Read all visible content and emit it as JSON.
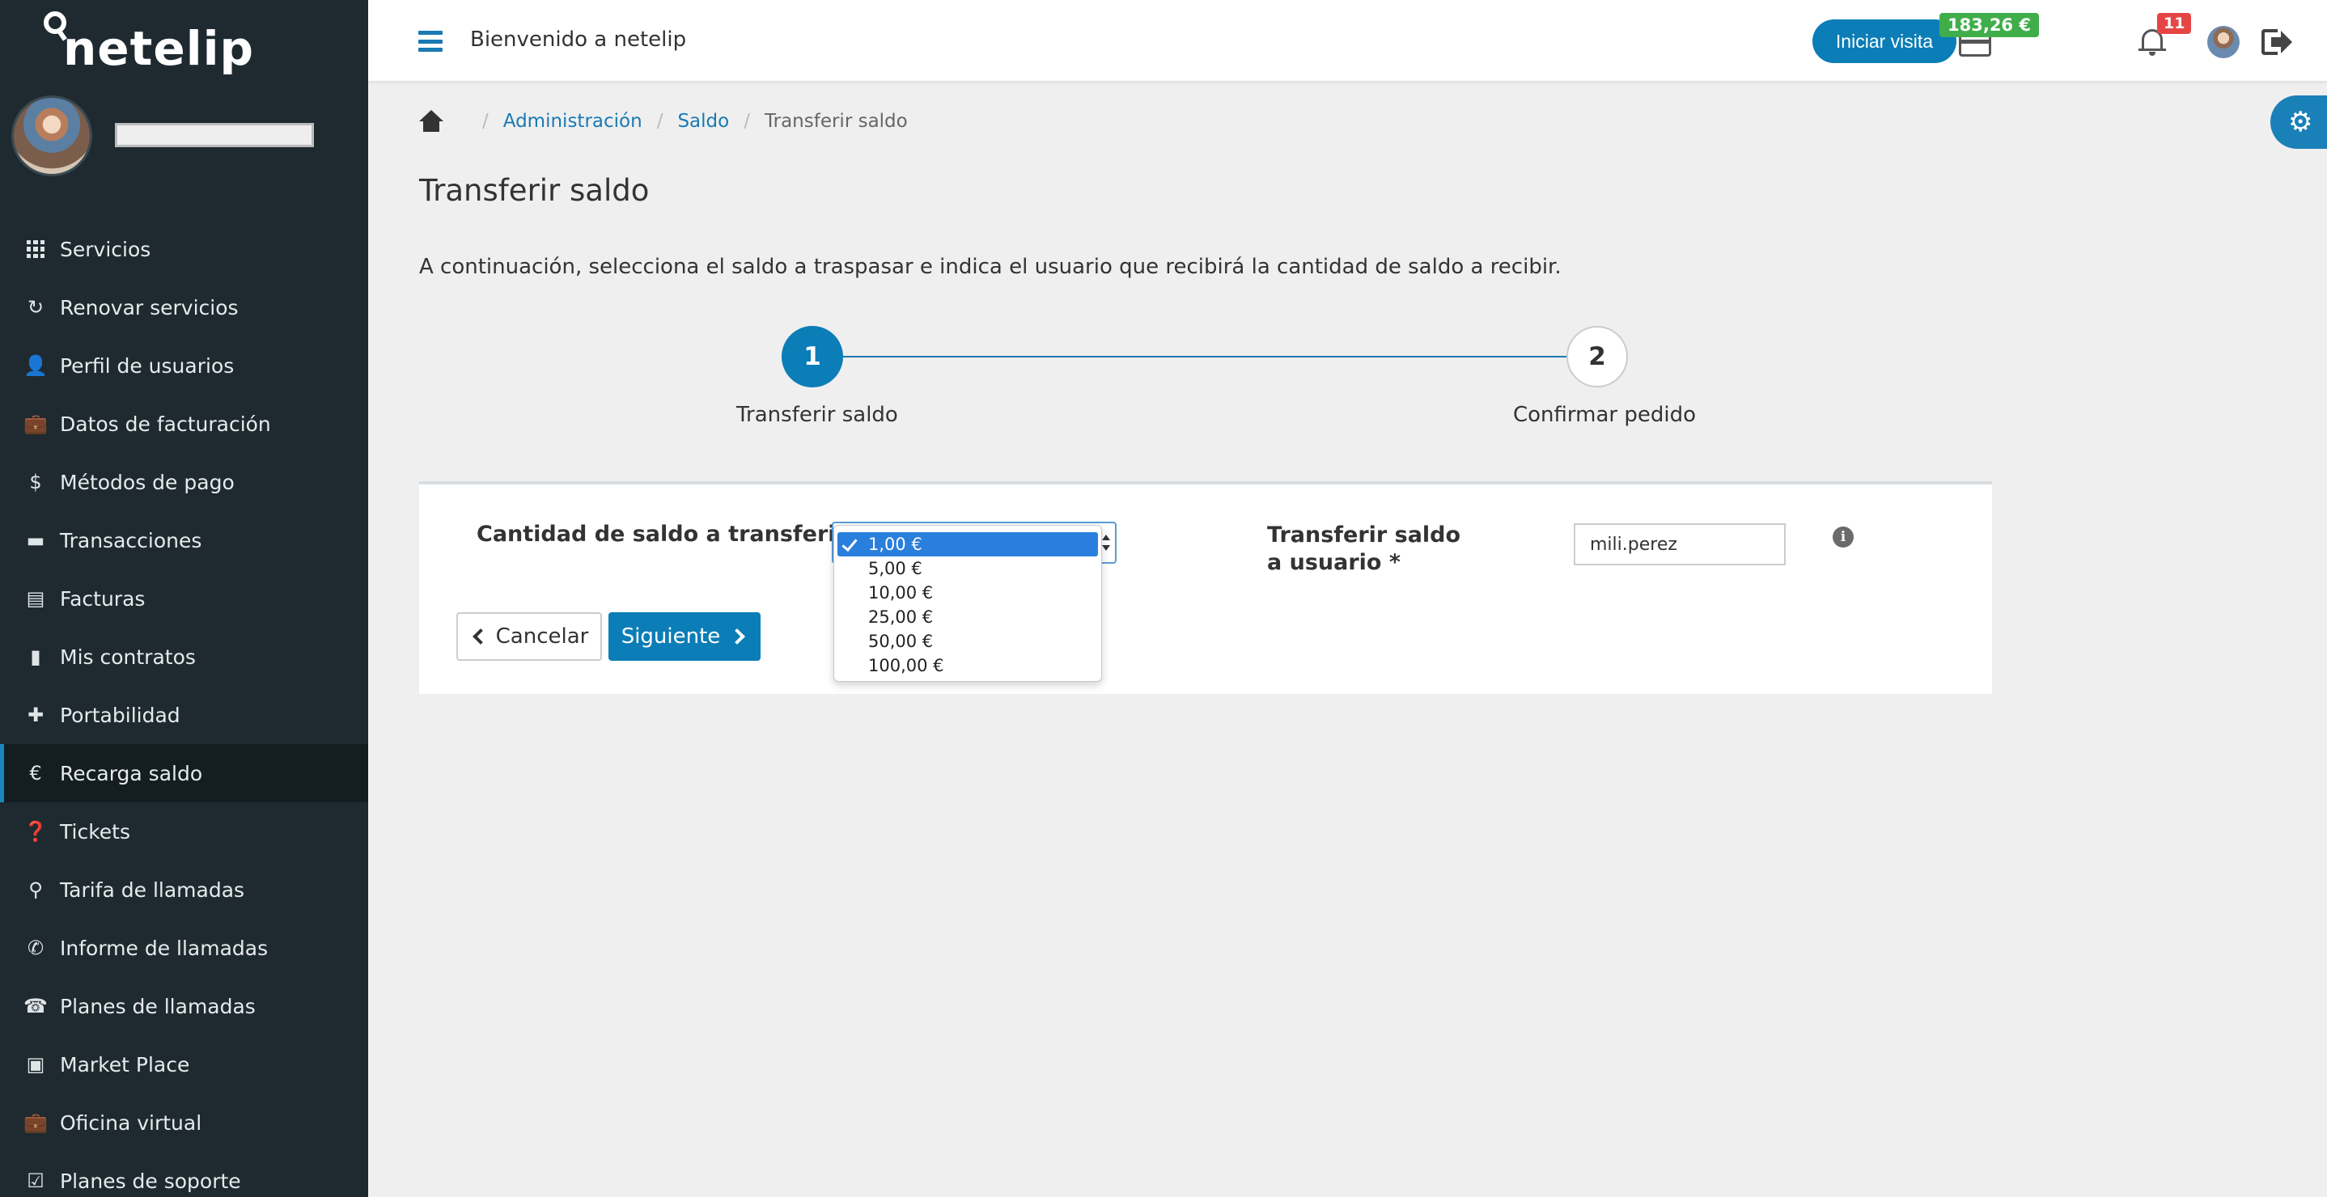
{
  "brand": {
    "logo_text": "netelip",
    "accent": "#0b7db7",
    "sidebar_bg": "#1e2a30"
  },
  "sidebar": {
    "items": [
      {
        "label": "Servicios",
        "icon": "grid-icon"
      },
      {
        "label": "Renovar servicios",
        "icon": "refresh-icon"
      },
      {
        "label": "Perfil de usuarios",
        "icon": "user-icon"
      },
      {
        "label": "Datos de facturación",
        "icon": "briefcase-icon"
      },
      {
        "label": "Métodos de pago",
        "icon": "dollar-icon"
      },
      {
        "label": "Transacciones",
        "icon": "credit-card-icon"
      },
      {
        "label": "Facturas",
        "icon": "invoice-icon"
      },
      {
        "label": "Mis contratos",
        "icon": "file-icon"
      },
      {
        "label": "Portabilidad",
        "icon": "plus-icon"
      },
      {
        "label": "Recarga saldo",
        "icon": "euro-icon",
        "active": true
      },
      {
        "label": "Tickets",
        "icon": "question-icon"
      },
      {
        "label": "Tarifa de llamadas",
        "icon": "search-icon"
      },
      {
        "label": "Informe de llamadas",
        "icon": "phone-icon"
      },
      {
        "label": "Planes de llamadas",
        "icon": "desk-phone-icon"
      },
      {
        "label": "Market Place",
        "icon": "market-icon"
      },
      {
        "label": "Oficina virtual",
        "icon": "briefcase-icon"
      },
      {
        "label": "Planes de soporte",
        "icon": "checkbox-icon"
      }
    ]
  },
  "header": {
    "welcome": "Bienvenido a netelip",
    "visit_button": "Iniciar visita",
    "balance": "183,26 €",
    "notifications_count": "11"
  },
  "breadcrumb": {
    "items": [
      "Administración",
      "Saldo"
    ],
    "current": "Transferir saldo"
  },
  "page": {
    "title": "Transferir saldo",
    "intro": "A continuación, selecciona el saldo a traspasar e indica el usuario que recibirá la cantidad de saldo a recibir."
  },
  "stepper": {
    "steps": [
      {
        "number": "1",
        "label": "Transferir saldo",
        "active": true
      },
      {
        "number": "2",
        "label": "Confirmar pedido",
        "active": false
      }
    ]
  },
  "form": {
    "amount_label": "Cantidad de saldo a transferir",
    "amount_options": [
      "1,00 €",
      "5,00 €",
      "10,00 €",
      "25,00 €",
      "50,00 €",
      "100,00 €"
    ],
    "amount_selected": "1,00 €",
    "user_label": "Transferir saldo a usuario",
    "required_mark": "*",
    "user_value": "mili.perez",
    "cancel_button": "Cancelar",
    "next_button": "Siguiente"
  }
}
